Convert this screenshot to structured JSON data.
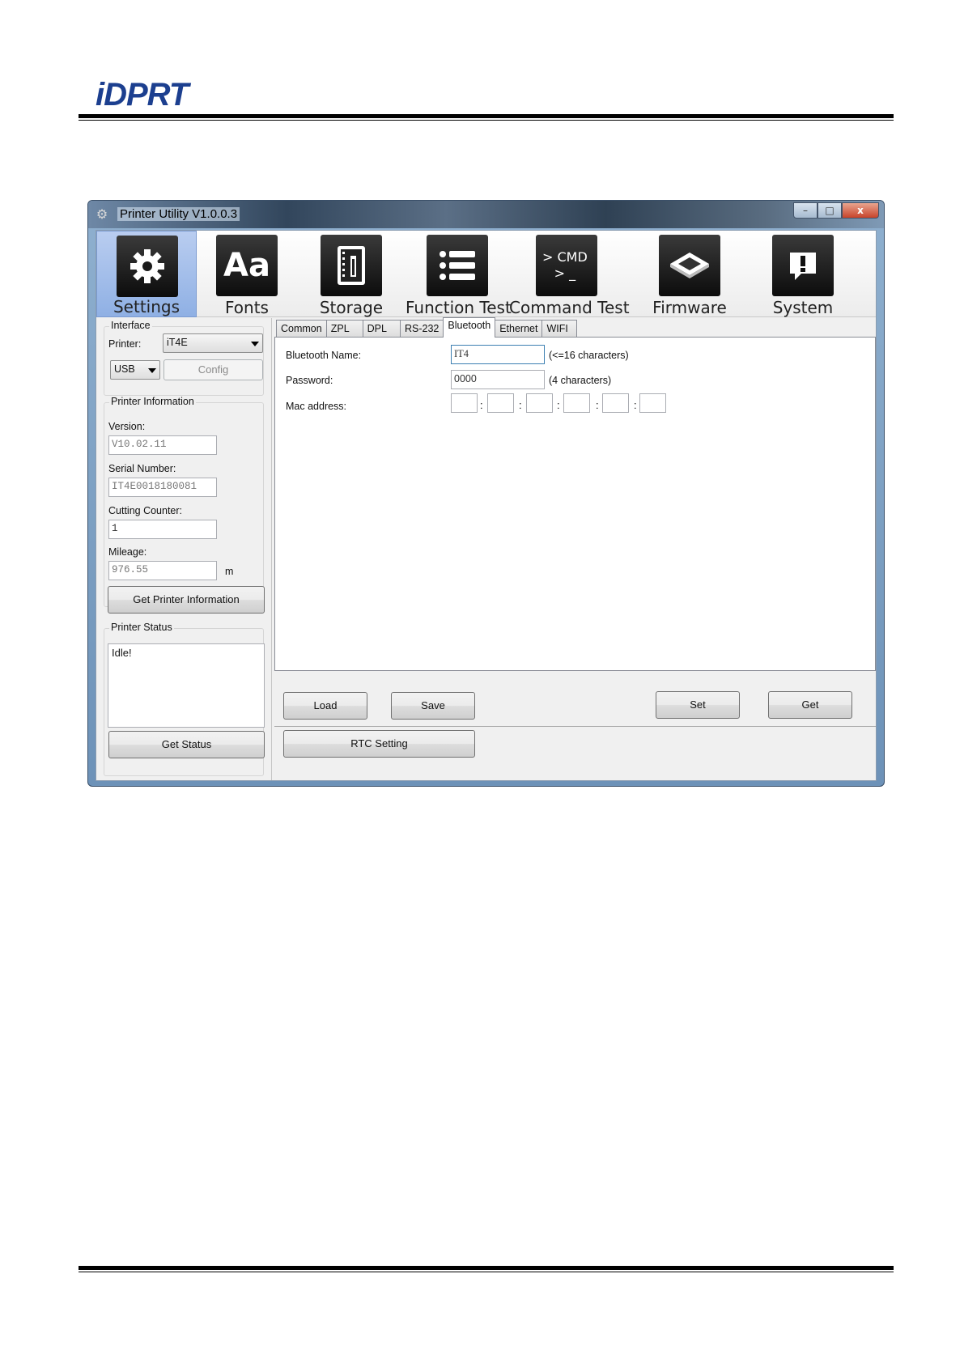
{
  "header": {
    "logo_text": "iDPRT"
  },
  "window": {
    "title": "Printer Utility  V1.0.0.3",
    "controls": {
      "minimize": "–",
      "maximize": "□",
      "close": "x"
    }
  },
  "toolbar": {
    "items": [
      {
        "label": "Settings",
        "icon": "gear-icon",
        "tile_text": "⚙",
        "active": true
      },
      {
        "label": "Fonts",
        "icon": "fonts-icon",
        "tile_text": "Aa"
      },
      {
        "label": "Storage",
        "icon": "storage-icon",
        "tile_text": ""
      },
      {
        "label": "Function Test",
        "icon": "list-icon",
        "tile_text": ""
      },
      {
        "label": "Command Test",
        "icon": "cmd-icon",
        "tile_text": "> CMD\n> _"
      },
      {
        "label": "Firmware",
        "icon": "chip-icon",
        "tile_text": ""
      },
      {
        "label": "System",
        "icon": "alert-icon",
        "tile_text": "!"
      }
    ]
  },
  "interface": {
    "group_label": "Interface",
    "printer_label": "Printer:",
    "printer_value": "iT4E",
    "port_value": "USB",
    "config_label": "Config"
  },
  "printer_info": {
    "group_label": "Printer Information",
    "version_label": "Version:",
    "version_value": "V10.02.11",
    "serial_label": "Serial Number:",
    "serial_value": "IT4E0018180081",
    "cutting_label": "Cutting Counter:",
    "cutting_value": "1",
    "mileage_label": "Mileage:",
    "mileage_value": "976.55",
    "mileage_unit": "m",
    "get_info_label": "Get Printer Information"
  },
  "printer_status": {
    "group_label": "Printer Status",
    "status_text": "Idle!",
    "get_status_label": "Get Status"
  },
  "tabs": [
    "Common",
    "ZPL",
    "DPL",
    "RS-232",
    "Bluetooth",
    "Ethernet",
    "WIFI"
  ],
  "active_tab": "Bluetooth",
  "bluetooth": {
    "name_label": "Bluetooth Name:",
    "name_value": "IT4",
    "name_hint": "(<=16 characters)",
    "password_label": "Password:",
    "password_value": "0000",
    "password_hint": "(4 characters)",
    "mac_label": "Mac address:",
    "mac_separator": ":"
  },
  "actions": {
    "load": "Load",
    "save": "Save",
    "set": "Set",
    "get": "Get",
    "rtc": "RTC Setting"
  }
}
